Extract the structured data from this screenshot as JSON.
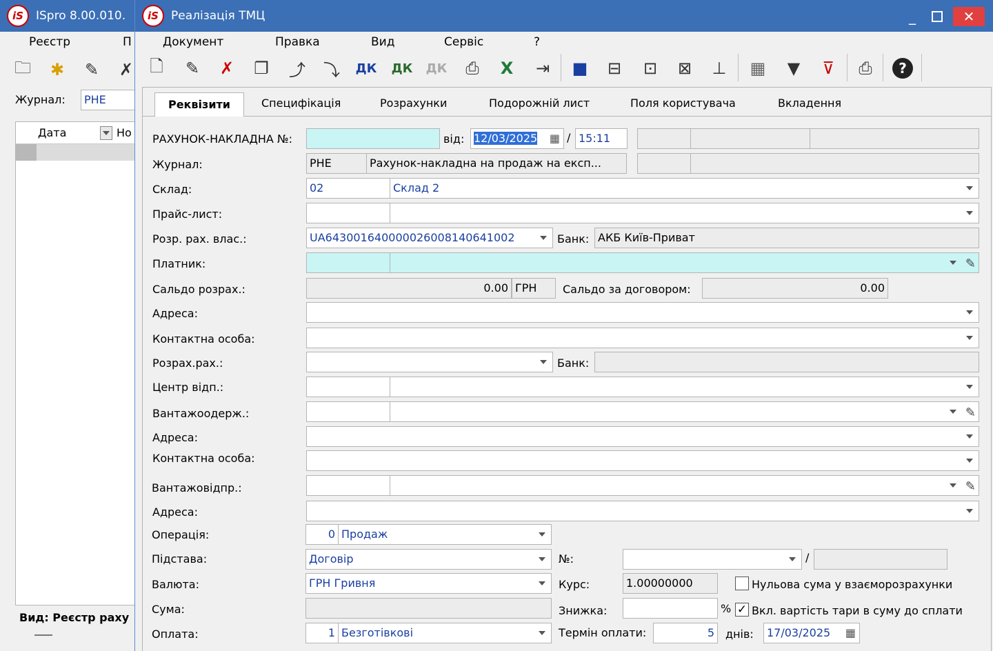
{
  "bg_window": {
    "title": "ISpro 8.00.010.",
    "menu": [
      "Реєстр",
      "П"
    ],
    "journal_label": "Журнал:",
    "journal_value": "РНЕ",
    "col_date": "Дата",
    "col_no": "Но",
    "footer": "Вид: Реєстр раху"
  },
  "window": {
    "title": "Реалізація ТМЦ",
    "btn_min": "_",
    "btn_close": "✕"
  },
  "menu": [
    "Документ",
    "Правка",
    "Вид",
    "Сервіс",
    "?"
  ],
  "tabs": [
    "Реквізити",
    "Специфікація",
    "Розрахунки",
    "Подорожній лист",
    "Поля користувача",
    "Вкладення"
  ],
  "form": {
    "invoice_label": "РАХУНОК-НАКЛАДНА №:",
    "invoice_no": "",
    "from_label": "від:",
    "date": "12/03/2025",
    "time": "15:11",
    "journal_label": "Журнал:",
    "journal_code": "РНЕ",
    "journal_name": "Рахунок-накладна на продаж на експ...",
    "warehouse_label": "Склад:",
    "warehouse_code": "02",
    "warehouse_name": "Склад 2",
    "pricelist_label": "Прайс-лист:",
    "own_account_label": "Розр. рах. влас.:",
    "own_account": "UA643001640000026008140641002",
    "bank_label": "Банк:",
    "bank_name": "АКБ Київ-Приват",
    "payer_label": "Платник:",
    "balance_label": "Сальдо розрах.:",
    "balance_value": "0.00",
    "balance_currency": "ГРН",
    "contract_balance_label": "Сальдо за договором:",
    "contract_balance_value": "0.00",
    "address_label": "Адреса:",
    "contact_label": "Контактна особа:",
    "account_label": "Розрах.рах.:",
    "bank2_label": "Банк:",
    "center_label": "Центр відп.:",
    "consignee_label": "Вантажоодерж.:",
    "address2_label": "Адреса:",
    "contact2_label": "Контактна особа:",
    "shipper_label": "Вантажовідпр.:",
    "address3_label": "Адреса:",
    "operation_label": "Операція:",
    "operation_code": "0",
    "operation_name": "Продаж",
    "basis_label": "Підстава:",
    "basis_value": "Договір",
    "no_label": "№:",
    "currency_label": "Валюта:",
    "currency_value": "ГРН Гривня",
    "rate_label": "Курс:",
    "rate_value": "1.00000000",
    "zero_sum_label": "Нульова сума у взаєморозрахунки",
    "sum_label": "Сума:",
    "discount_label": "Знижка:",
    "pct": "%",
    "tare_label": "Вкл. вартість тари в суму до сплати",
    "payment_label": "Оплата:",
    "payment_code": "1",
    "payment_name": "Безготівкові",
    "term_label": "Термін оплати:",
    "term_value": "5",
    "days_label": "днів:",
    "due_date": "17/03/2025"
  }
}
